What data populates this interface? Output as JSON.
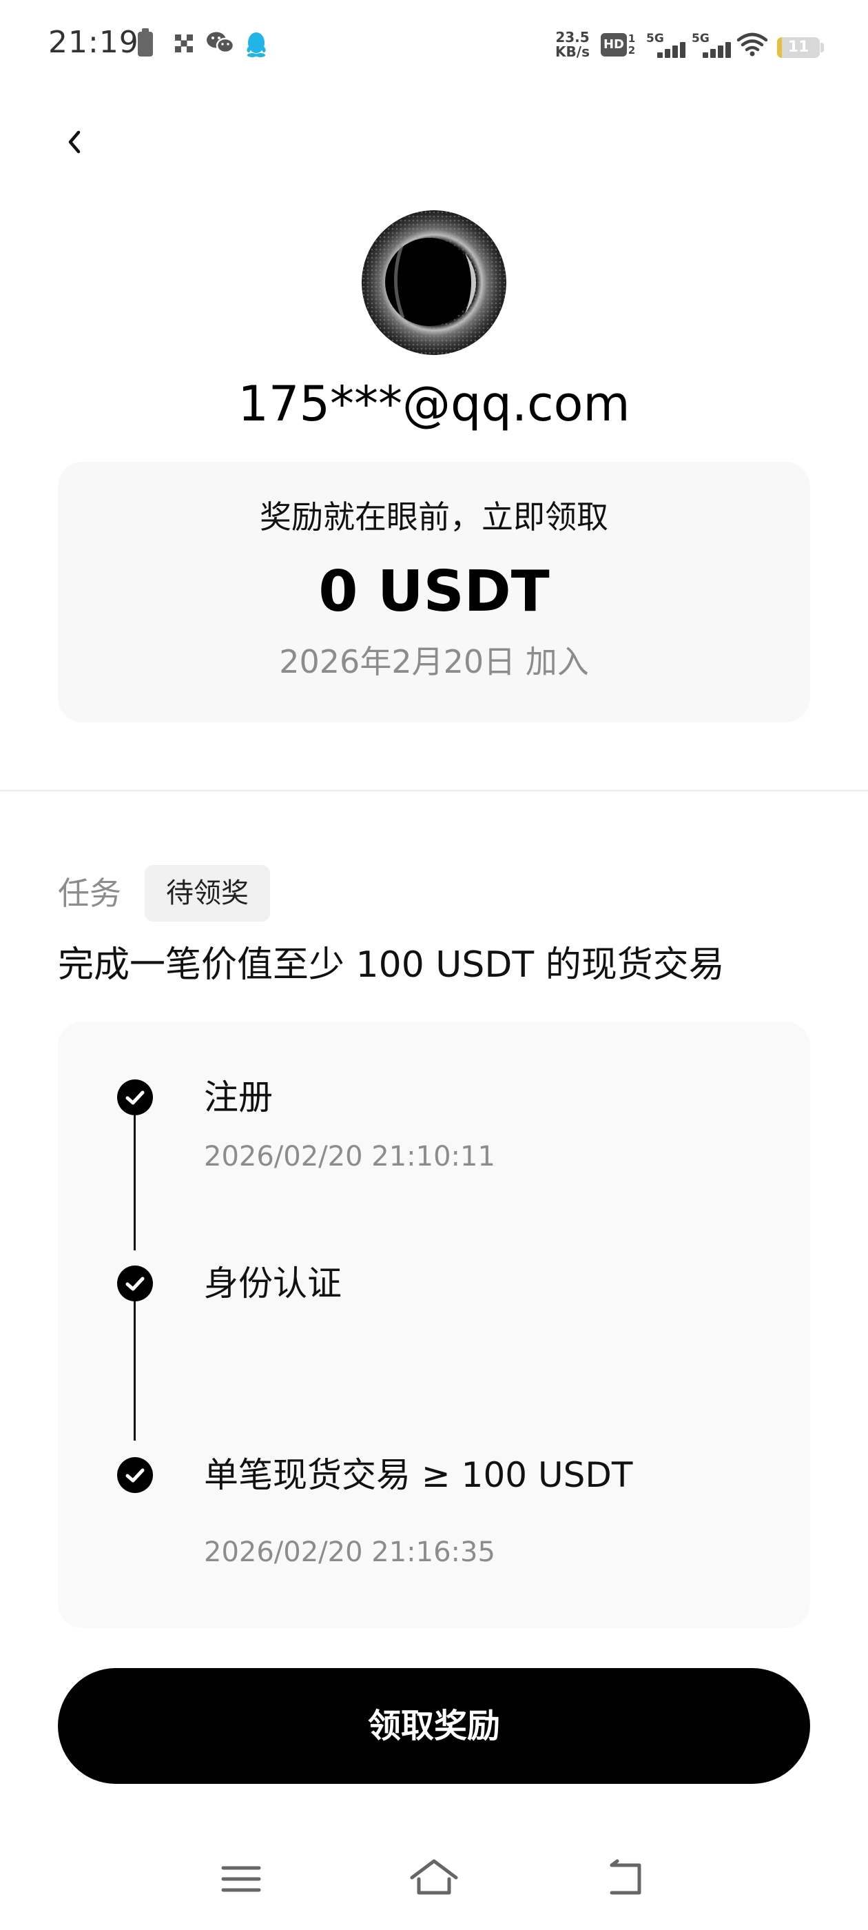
{
  "status_bar": {
    "time": "21:19",
    "network_speed_value": "23.5",
    "network_speed_unit": "KB/s",
    "hd_label": "HD",
    "hd_sub_top": "1",
    "hd_sub_bottom": "2",
    "sim1_label": "5G",
    "sim2_label": "5G",
    "battery_level": "11",
    "battery_fill_color": "#e6bf3c",
    "icons": [
      "battery-saver-icon",
      "grid-app-icon",
      "wechat-icon",
      "qq-icon",
      "wifi-icon",
      "battery-icon"
    ]
  },
  "header": {
    "back_icon": "chevron-left-icon"
  },
  "profile": {
    "email": "175***@qq.com"
  },
  "reward": {
    "title": "奖励就在眼前，立即领取",
    "amount": "0 USDT",
    "joined_date": "2026年2月20日 加入"
  },
  "task": {
    "label": "任务",
    "status": "待领奖",
    "title": "完成一笔价值至少 100 USDT 的现货交易",
    "steps": [
      {
        "label": "注册",
        "time": "2026/02/20 21:10:11",
        "done": true
      },
      {
        "label": "身份认证",
        "time": "",
        "done": true
      },
      {
        "label": "单笔现货交易 ≥ 100 USDT",
        "time": "2026/02/20 21:16:35",
        "done": true
      }
    ]
  },
  "claim_button": {
    "label": "领取奖励"
  },
  "nav_bar": {
    "icons": [
      "menu-icon",
      "home-icon",
      "back-icon"
    ]
  },
  "colors": {
    "accent": "#000000",
    "card_background": "#f8f8f8",
    "muted_text": "#8c8c8c"
  }
}
